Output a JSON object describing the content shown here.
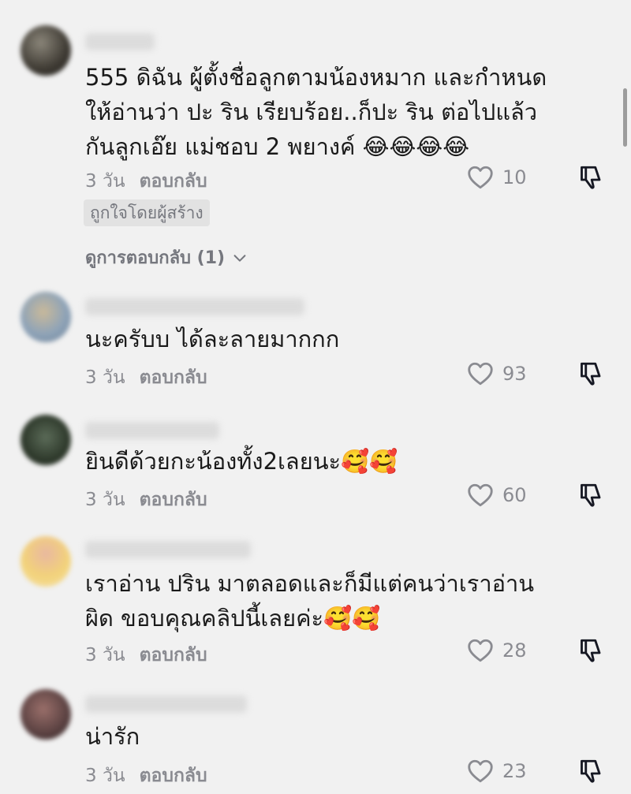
{
  "comments": [
    {
      "text_lines": [
        "555 ดิฉัน ผู้ตั้งชื่อลูกตามน้องหมาก และกำหนด",
        "ให้อ่านว่า ปะ ริน เรียบร้อย..ก็ปะ ริน ต่อไปแล้ว",
        "กันลูกเอ๊ย แม่ชอบ 2 พยางค์ 😂😂😂😂"
      ],
      "time": "3 วัน",
      "reply_label": "ตอบกลับ",
      "likes": "10",
      "creator_badge": "ถูกใจโดยผู้สร้าง",
      "view_replies": "ดูการตอบกลับ (1)"
    },
    {
      "text_lines": [
        "นะครับบ ได้ละลายมากกก"
      ],
      "time": "3 วัน",
      "reply_label": "ตอบกลับ",
      "likes": "93"
    },
    {
      "text_lines": [
        "ยินดีด้วยกะน้องทั้ง2เลยนะ🥰🥰"
      ],
      "time": "3 วัน",
      "reply_label": "ตอบกลับ",
      "likes": "60"
    },
    {
      "text_lines": [
        "เราอ่าน ปริน มาตลอดและก็มีแต่คนว่าเราอ่าน",
        "ผิด  ขอบคุณคลิปนี้เลยค่ะ🥰🥰"
      ],
      "time": "3 วัน",
      "reply_label": "ตอบกลับ",
      "likes": "28"
    },
    {
      "text_lines": [
        "น่ารัก"
      ],
      "time": "3 วัน",
      "reply_label": "ตอบกลับ",
      "likes": "23"
    }
  ],
  "icons": {
    "like": "heart-outline-icon",
    "dislike": "thumbs-down-outline-icon",
    "expand": "chevron-down-icon"
  },
  "colors": {
    "background": "#f1f1f1",
    "text": "#1a1a1a",
    "meta": "#8a8b91"
  }
}
